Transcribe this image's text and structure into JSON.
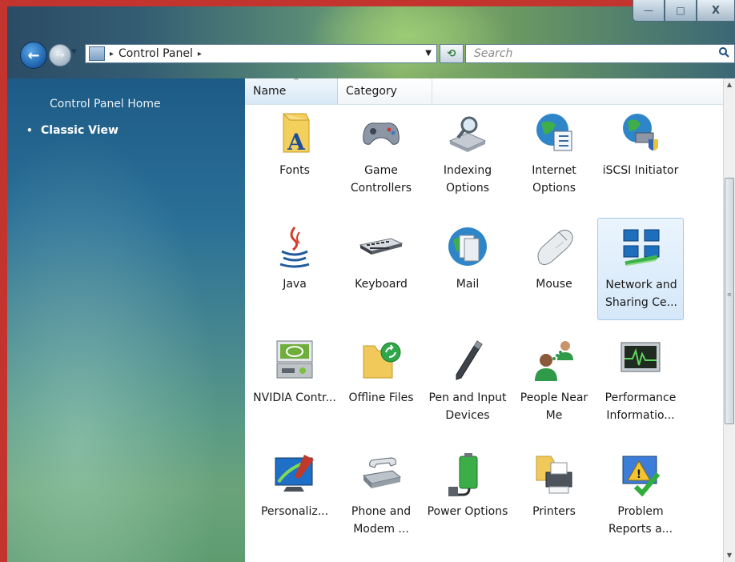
{
  "window": {
    "caption": {
      "minimize": "—",
      "maximize": "□",
      "close": "X"
    }
  },
  "nav": {
    "back_glyph": "←",
    "forward_glyph": "→",
    "history_glyph": "▼",
    "address": {
      "separator": "▸",
      "path": "Control Panel",
      "trail": "▸",
      "dropdown": "▼"
    },
    "refresh_glyph": "⟲",
    "search": {
      "placeholder": "Search",
      "icon": "search-icon"
    }
  },
  "sidebar": {
    "home_label": "Control Panel Home",
    "classic_bullet": "•",
    "classic_label": "Classic View"
  },
  "columns": {
    "name": "Name",
    "sort_glyph": "^",
    "category": "Category"
  },
  "items": [
    {
      "label": "Fonts",
      "icon": "fonts-icon"
    },
    {
      "label": "Game Controllers",
      "icon": "game-controllers-icon"
    },
    {
      "label": "Indexing Options",
      "icon": "indexing-options-icon"
    },
    {
      "label": "Internet Options",
      "icon": "internet-options-icon"
    },
    {
      "label": "iSCSI Initiator",
      "icon": "iscsi-initiator-icon"
    },
    {
      "label": "Java",
      "icon": "java-icon"
    },
    {
      "label": "Keyboard",
      "icon": "keyboard-icon"
    },
    {
      "label": "Mail",
      "icon": "mail-icon"
    },
    {
      "label": "Mouse",
      "icon": "mouse-icon"
    },
    {
      "label": "Network and Sharing Ce...",
      "icon": "network-sharing-icon",
      "selected": true
    },
    {
      "label": "NVIDIA Contr...",
      "icon": "nvidia-control-icon"
    },
    {
      "label": "Offline Files",
      "icon": "offline-files-icon"
    },
    {
      "label": "Pen and Input Devices",
      "icon": "pen-input-icon"
    },
    {
      "label": "People Near Me",
      "icon": "people-near-me-icon"
    },
    {
      "label": "Performance Informatio...",
      "icon": "performance-info-icon"
    },
    {
      "label": "Personaliz...",
      "icon": "personalization-icon"
    },
    {
      "label": "Phone and Modem ...",
      "icon": "phone-modem-icon"
    },
    {
      "label": "Power Options",
      "icon": "power-options-icon"
    },
    {
      "label": "Printers",
      "icon": "printers-icon"
    },
    {
      "label": "Problem Reports a...",
      "icon": "problem-reports-icon"
    }
  ],
  "scrollbar": {
    "up_glyph": "▲",
    "down_glyph": "▼",
    "grip_glyph": "≡"
  },
  "colors": {
    "accent": "#1b5fa8",
    "frame_border": "#c3342f",
    "selection": "#d5e8f9"
  }
}
